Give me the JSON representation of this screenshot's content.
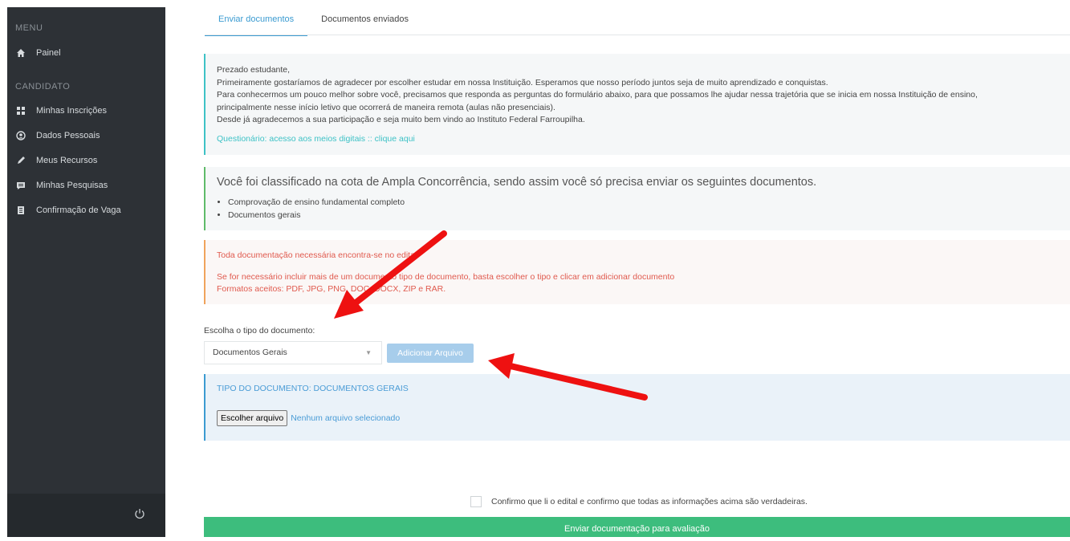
{
  "sidebar": {
    "menu_title": "MENU",
    "items_menu": [
      {
        "label": "Painel",
        "icon": "home-icon"
      }
    ],
    "candidate_title": "CANDIDATO",
    "items_candidate": [
      {
        "label": "Minhas Inscrições",
        "icon": "grid-icon"
      },
      {
        "label": "Dados Pessoais",
        "icon": "user-circle-icon"
      },
      {
        "label": "Meus Recursos",
        "icon": "pencil-icon"
      },
      {
        "label": "Minhas Pesquisas",
        "icon": "message-icon"
      },
      {
        "label": "Confirmação de Vaga",
        "icon": "document-icon"
      }
    ],
    "power_icon": "power-icon"
  },
  "tabs": [
    {
      "label": "Enviar documentos",
      "active": true
    },
    {
      "label": "Documentos enviados",
      "active": false
    }
  ],
  "info": {
    "lines": [
      "Prezado estudante,",
      "Primeiramente gostaríamos de agradecer por escolher estudar em nossa Instituição. Esperamos que nosso período juntos seja de muito aprendizado e conquistas.",
      "Para conhecermos um pouco melhor sobre você, precisamos que responda as perguntas do formulário abaixo, para que possamos lhe ajudar nessa trajetória que se inicia em nossa Instituição de ensino,",
      "principalmente nesse início letivo que ocorrerá de maneira remota (aulas não presenciais).",
      "Desde já agradecemos a sua participação e seja muito bem vindo ao Instituto Federal Farroupilha."
    ],
    "link": "Questionário: acesso aos meios digitais :: clique aqui"
  },
  "quota": {
    "heading": "Você foi classificado na cota de Ampla Concorrência, sendo assim você só precisa enviar os seguintes documentos.",
    "items": [
      "Comprovação de ensino fundamental completo",
      "Documentos gerais"
    ]
  },
  "warning": {
    "line1": "Toda documentação necessária encontra-se no edital.",
    "line2": "Se for necessário incluir mais de um documento tipo de documento, basta escolher o tipo e clicar em adicionar documento",
    "line3": "Formatos aceitos: PDF, JPG, PNG, DOC, DOCX, ZIP e RAR."
  },
  "form": {
    "choose_label": "Escolha o tipo do documento:",
    "select_value": "Documentos Gerais",
    "add_button": "Adicionar Arquivo"
  },
  "doc_type": {
    "title": "TIPO DO DOCUMENTO: DOCUMENTOS GERAIS",
    "choose_file": "Escolher arquivo",
    "no_file": "Nenhum arquivo selecionado"
  },
  "confirm_text": "Confirmo que li o edital e confirmo que todas as informações acima são verdadeiras.",
  "submit_button": "Enviar documentação para avaliação",
  "colors": {
    "sidebar_bg": "#2d3136",
    "accent_blue": "#3b9bd1",
    "teal": "#3ec2c6",
    "green": "#3dbd7d",
    "warning_red": "#e05a4e",
    "annotation_arrow": "#ee1111"
  }
}
